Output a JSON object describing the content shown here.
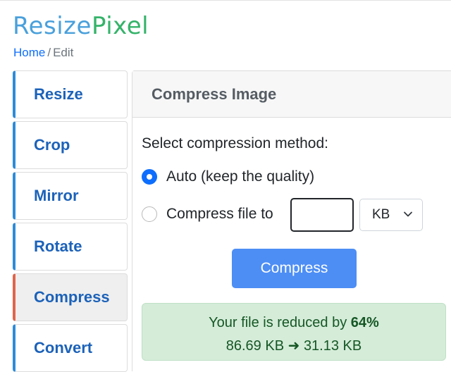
{
  "logo": {
    "part1": "Resize",
    "part2": "Pixel"
  },
  "breadcrumb": {
    "home": "Home",
    "separator": "/",
    "current": "Edit"
  },
  "sidebar": {
    "items": [
      {
        "label": "Resize"
      },
      {
        "label": "Crop"
      },
      {
        "label": "Mirror"
      },
      {
        "label": "Rotate"
      },
      {
        "label": "Compress",
        "active": true
      },
      {
        "label": "Convert"
      }
    ]
  },
  "panel": {
    "title": "Compress Image",
    "method_label": "Select compression method:",
    "option_auto": "Auto (keep the quality)",
    "option_size": "Compress file to",
    "size_input_value": "",
    "unit_selected": "KB",
    "button_label": "Compress",
    "result": {
      "prefix": "Your file is reduced by",
      "percent": "64%",
      "original": "86.69 KB",
      "arrow": "➜",
      "compressed": "31.13 KB"
    }
  },
  "colors": {
    "nav_accent": "#2f8bd8",
    "nav_active_accent": "#e0654a",
    "button": "#4d8ef5",
    "success_bg": "#d5ecd9"
  }
}
